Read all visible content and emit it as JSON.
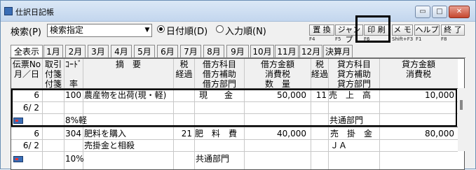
{
  "window": {
    "title": "仕訳日記帳",
    "min": "▭",
    "max": "□",
    "close": "✕"
  },
  "toolbar": {
    "search_label": "検索(P)",
    "search_value": "検索指定",
    "radio_date": "日付順(D)",
    "radio_input": "入力順(N)",
    "buttons": [
      {
        "label": "置 換",
        "key": "F4"
      },
      {
        "label": "ジャンプ",
        "key": "F5"
      },
      {
        "label": "印 刷",
        "key": "F6"
      },
      {
        "label": "メ モ",
        "key": "Shift+F3"
      },
      {
        "label": "ヘルプ",
        "key": "F1"
      },
      {
        "label": "終 了",
        "key": "F8"
      }
    ]
  },
  "tabs": [
    "全表示",
    "1月",
    "2月",
    "3月",
    "4月",
    "5月",
    "6月",
    "7月",
    "8月",
    "9月",
    "10月",
    "11月",
    "12月",
    "決算月"
  ],
  "headers": {
    "denpyo_no": "伝票No",
    "date": "月／日",
    "torihiki": "取引",
    "fusen1": "付箋",
    "fusen2": "付箋",
    "code": "ｺｰﾄﾞ",
    "rate": "率",
    "tekiyo": "摘　要",
    "zei1": "税",
    "keigen1": "経過",
    "kari_kamoku": "借方科目",
    "kari_hojo": "借方補助",
    "kari_bumon": "借方部門",
    "kari_kingaku": "借方金額",
    "kari_shohizei": "消費税",
    "suryo": "数　量",
    "zei2": "税",
    "keigen2": "経過",
    "kashi_kamoku": "貸方科目",
    "kashi_hojo": "貸方補助",
    "kashi_bumon": "貸方部門",
    "kashi_kingaku": "貸方金額",
    "kashi_shohizei": "消費税"
  },
  "entries": [
    {
      "no": "6",
      "date": "6/ 2",
      "code": "100",
      "tekiyo": "農産物を出荷(現・軽)",
      "tekiyo2": "",
      "rate": "8%軽",
      "zei": "",
      "kari_kamoku": "現　　金",
      "kari_bumon": "",
      "kari_kingaku": "50,000",
      "zei2": "11",
      "kashi_kamoku": "売　上　高",
      "kashi_hojo": "",
      "kashi_bumon": "共通部門",
      "kashi_kingaku": "10,000"
    },
    {
      "no": "6",
      "date": "6/ 2",
      "code": "304",
      "tekiyo": "肥料を購入",
      "tekiyo2": "売掛金と相殺",
      "rate": "10%",
      "zei": "21",
      "kari_kamoku": "肥　料　費",
      "kari_bumon": "共通部門",
      "kari_kingaku": "40,000",
      "zei2": "",
      "kashi_kamoku": "売　掛　金",
      "kashi_hojo": "ＪＡ",
      "kashi_bumon": "",
      "kashi_kingaku": "80,000"
    }
  ]
}
